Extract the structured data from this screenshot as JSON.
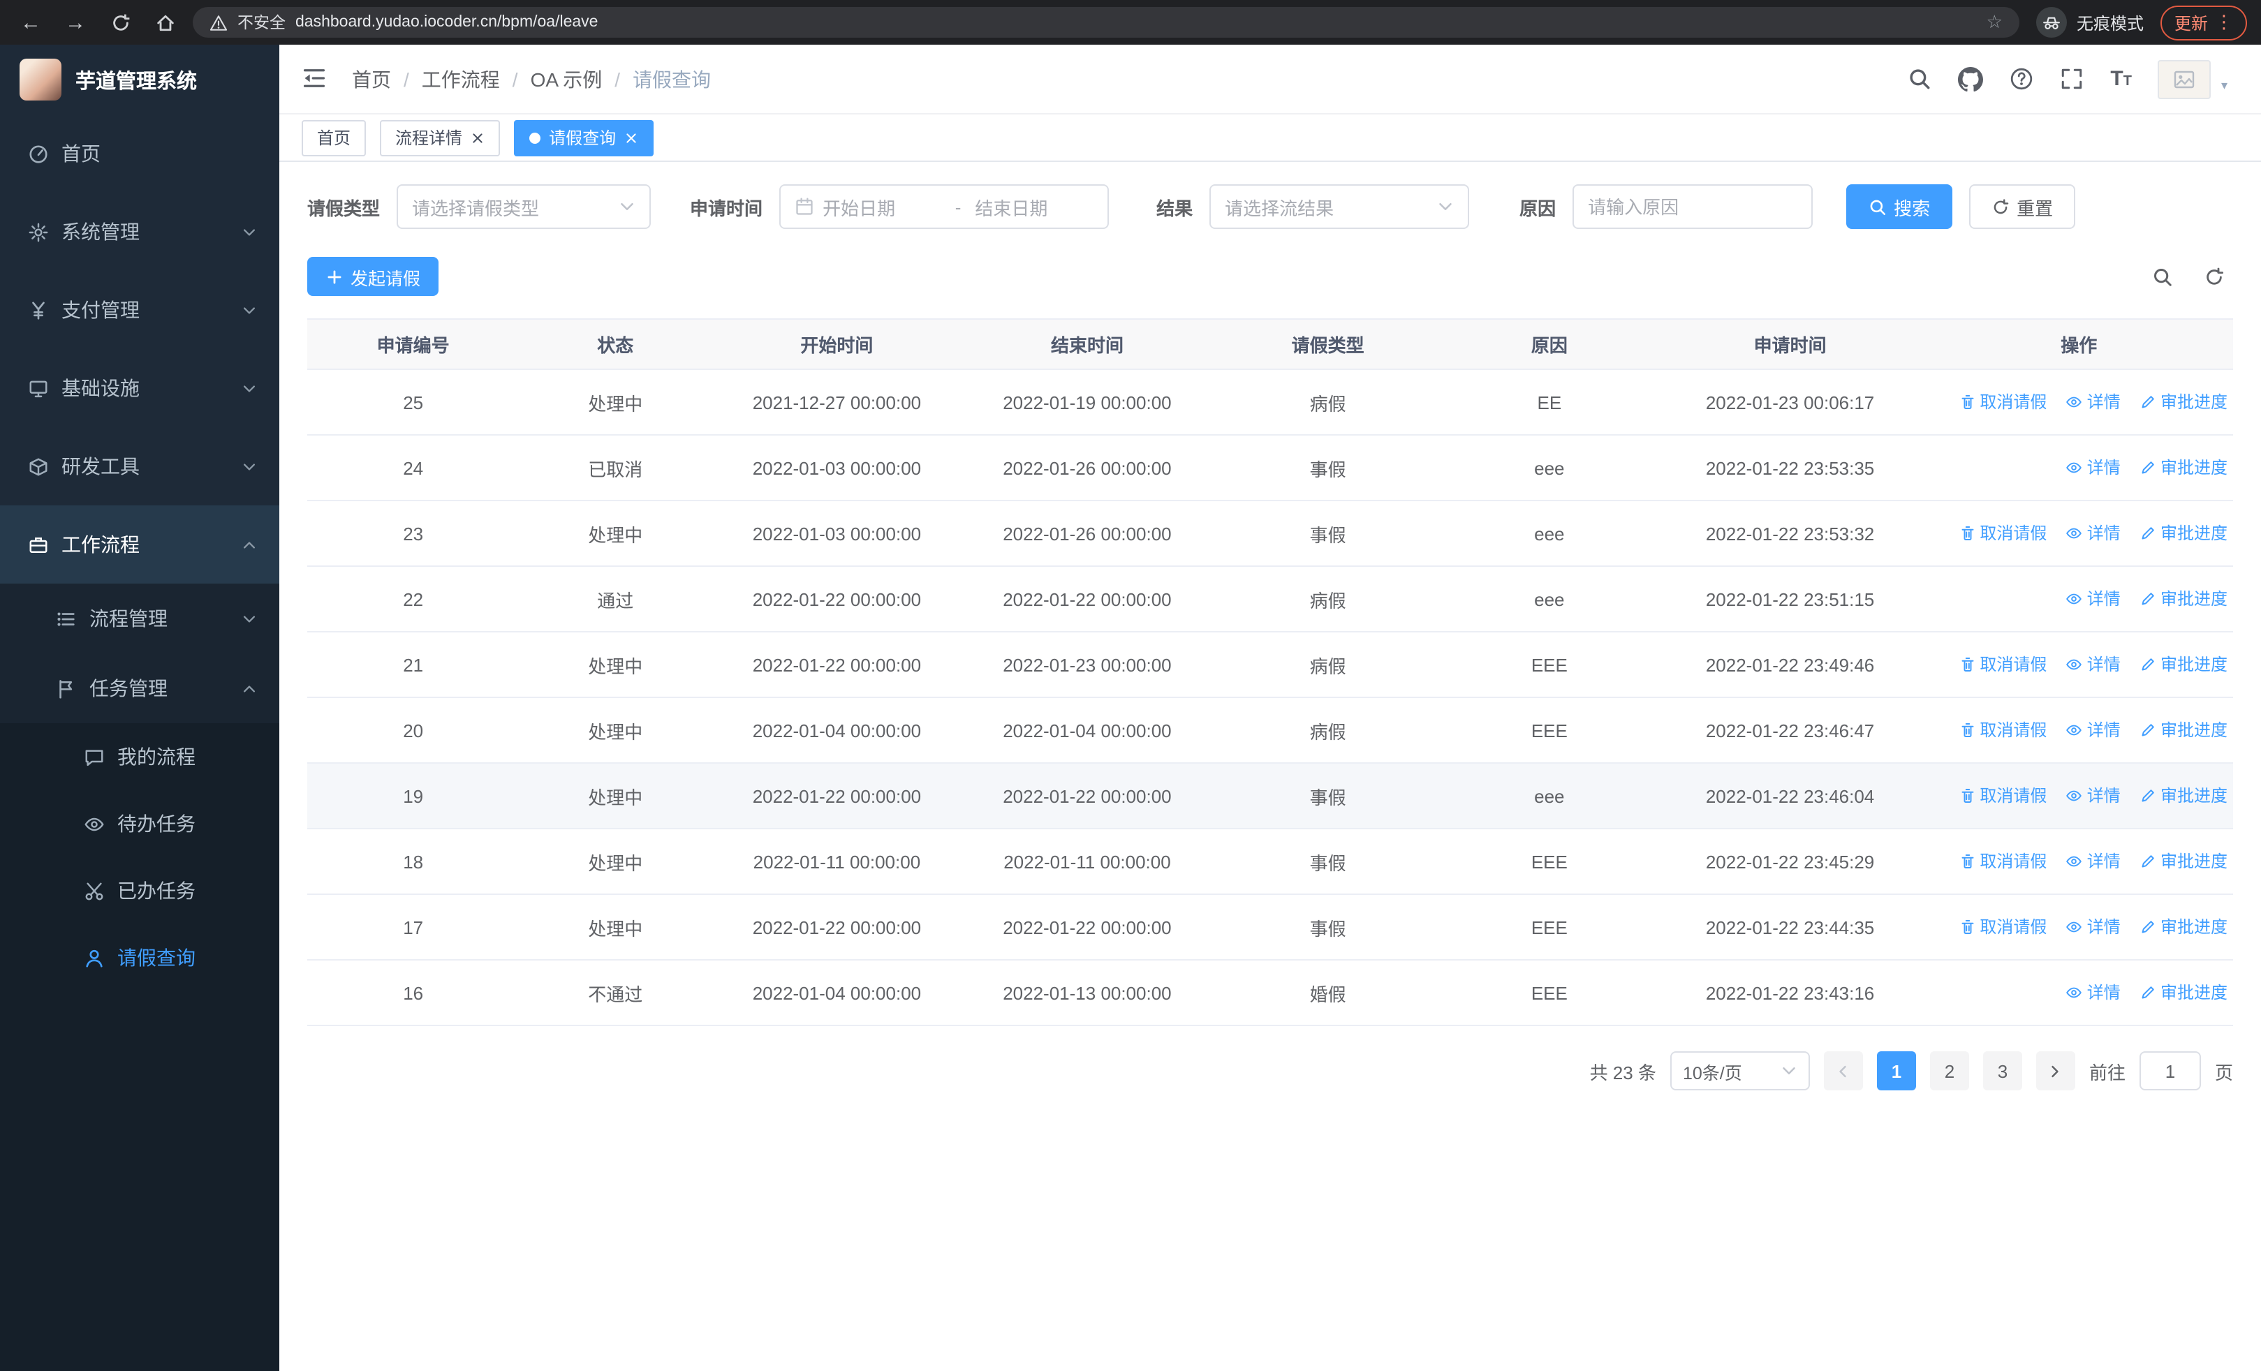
{
  "theme": {
    "primary": "#409eff",
    "sidebar_bg": "#1e2a38",
    "submenu_bg": "#1a2531",
    "submenu_deep_bg": "#151f29",
    "sidebar_active_parent_bg": "#263a4c",
    "sidebar_text": "#b8c4cf",
    "chrome_bg": "#202124",
    "urlbar_bg": "#35363a",
    "update_red": "#e25a41",
    "table_border": "#ebeef5",
    "table_header_bg": "#f8f8f9",
    "hover_row_bg": "#f5f7fa"
  },
  "browser": {
    "security_warning": "不安全",
    "url": "dashboard.yudao.iocoder.cn/bpm/oa/leave",
    "incognito_label": "无痕模式",
    "update_label": "更新"
  },
  "sidebar": {
    "logo_title": "芋道管理系统",
    "items": [
      {
        "label": "首页"
      },
      {
        "label": "系统管理"
      },
      {
        "label": "支付管理"
      },
      {
        "label": "基础设施"
      },
      {
        "label": "研发工具"
      },
      {
        "label": "工作流程"
      }
    ],
    "workflow_children": [
      {
        "label": "流程管理"
      },
      {
        "label": "任务管理"
      }
    ],
    "task_children": [
      {
        "label": "我的流程"
      },
      {
        "label": "待办任务"
      },
      {
        "label": "已办任务"
      },
      {
        "label": "请假查询"
      }
    ]
  },
  "header": {
    "breadcrumb": [
      "首页",
      "工作流程",
      "OA 示例",
      "请假查询"
    ]
  },
  "tabs": [
    {
      "label": "首页"
    },
    {
      "label": "流程详情"
    },
    {
      "label": "请假查询"
    }
  ],
  "filters": {
    "leave_type_label": "请假类型",
    "leave_type_placeholder": "请选择请假类型",
    "apply_time_label": "申请时间",
    "start_date_placeholder": "开始日期",
    "range_separator": "-",
    "end_date_placeholder": "结束日期",
    "result_label": "结果",
    "result_placeholder": "请选择流结果",
    "reason_label": "原因",
    "reason_placeholder": "请输入原因",
    "search_label": "搜索",
    "reset_label": "重置"
  },
  "toolbar": {
    "create_label": "发起请假"
  },
  "table": {
    "columns": [
      "申请编号",
      "状态",
      "开始时间",
      "结束时间",
      "请假类型",
      "原因",
      "申请时间",
      "操作"
    ],
    "actions": {
      "cancel": "取消请假",
      "detail": "详情",
      "progress": "审批进度"
    },
    "rows": [
      {
        "id": "25",
        "status": "处理中",
        "start": "2021-12-27 00:00:00",
        "end": "2022-01-19 00:00:00",
        "type": "病假",
        "reason": "EE",
        "applied": "2022-01-23 00:06:17",
        "cancellable": true,
        "highlighted": false
      },
      {
        "id": "24",
        "status": "已取消",
        "start": "2022-01-03 00:00:00",
        "end": "2022-01-26 00:00:00",
        "type": "事假",
        "reason": "eee",
        "applied": "2022-01-22 23:53:35",
        "cancellable": false,
        "highlighted": false
      },
      {
        "id": "23",
        "status": "处理中",
        "start": "2022-01-03 00:00:00",
        "end": "2022-01-26 00:00:00",
        "type": "事假",
        "reason": "eee",
        "applied": "2022-01-22 23:53:32",
        "cancellable": true,
        "highlighted": false
      },
      {
        "id": "22",
        "status": "通过",
        "start": "2022-01-22 00:00:00",
        "end": "2022-01-22 00:00:00",
        "type": "病假",
        "reason": "eee",
        "applied": "2022-01-22 23:51:15",
        "cancellable": false,
        "highlighted": false
      },
      {
        "id": "21",
        "status": "处理中",
        "start": "2022-01-22 00:00:00",
        "end": "2022-01-23 00:00:00",
        "type": "病假",
        "reason": "EEE",
        "applied": "2022-01-22 23:49:46",
        "cancellable": true,
        "highlighted": false
      },
      {
        "id": "20",
        "status": "处理中",
        "start": "2022-01-04 00:00:00",
        "end": "2022-01-04 00:00:00",
        "type": "病假",
        "reason": "EEE",
        "applied": "2022-01-22 23:46:47",
        "cancellable": true,
        "highlighted": false
      },
      {
        "id": "19",
        "status": "处理中",
        "start": "2022-01-22 00:00:00",
        "end": "2022-01-22 00:00:00",
        "type": "事假",
        "reason": "eee",
        "applied": "2022-01-22 23:46:04",
        "cancellable": true,
        "highlighted": true
      },
      {
        "id": "18",
        "status": "处理中",
        "start": "2022-01-11 00:00:00",
        "end": "2022-01-11 00:00:00",
        "type": "事假",
        "reason": "EEE",
        "applied": "2022-01-22 23:45:29",
        "cancellable": true,
        "highlighted": false
      },
      {
        "id": "17",
        "status": "处理中",
        "start": "2022-01-22 00:00:00",
        "end": "2022-01-22 00:00:00",
        "type": "事假",
        "reason": "EEE",
        "applied": "2022-01-22 23:44:35",
        "cancellable": true,
        "highlighted": false
      },
      {
        "id": "16",
        "status": "不通过",
        "start": "2022-01-04 00:00:00",
        "end": "2022-01-13 00:00:00",
        "type": "婚假",
        "reason": "EEE",
        "applied": "2022-01-22 23:43:16",
        "cancellable": false,
        "highlighted": false
      }
    ]
  },
  "pagination": {
    "total_label": "共 23 条",
    "page_size": "10条/页",
    "pages": [
      "1",
      "2",
      "3"
    ],
    "active_page": "1",
    "goto_label": "前往",
    "goto_value": "1",
    "page_label": "页"
  }
}
